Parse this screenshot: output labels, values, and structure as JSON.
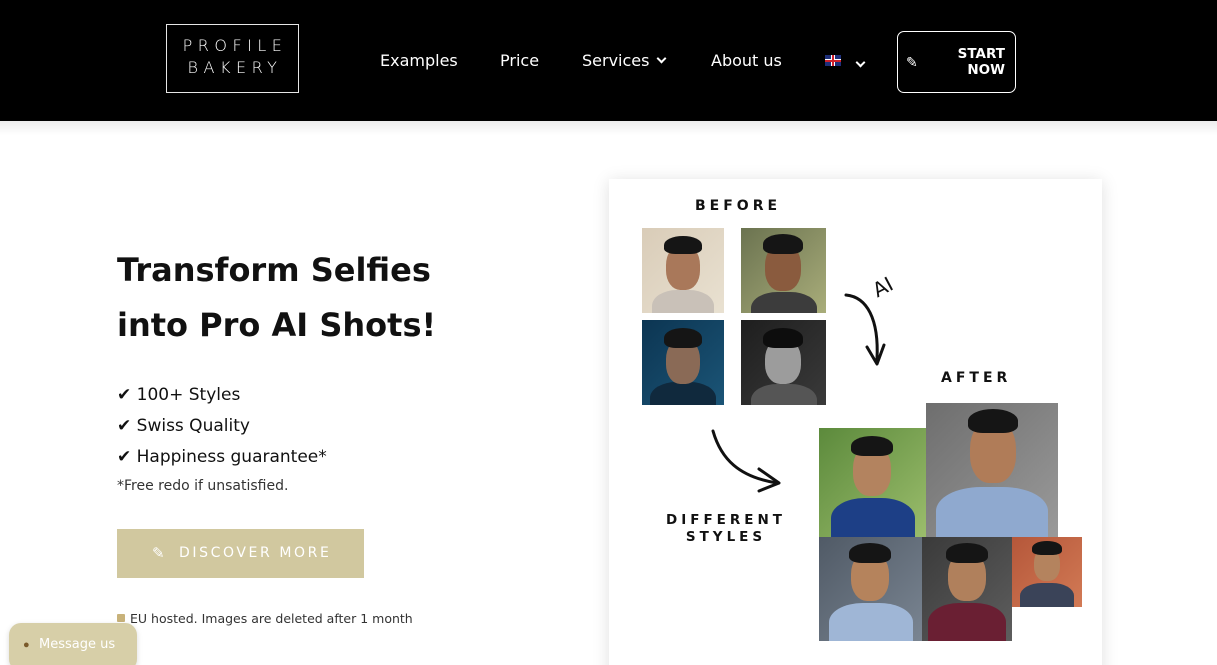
{
  "brand": {
    "line1": "PROFILE",
    "line2": "BAKERY"
  },
  "nav": {
    "examples": "Examples",
    "price": "Price",
    "services": "Services",
    "about": "About us"
  },
  "cta": {
    "start_line1": "START",
    "start_line2": "NOW"
  },
  "hero": {
    "headline_line1": "Transform Selfies",
    "headline_line2": "into Pro AI Shots!",
    "bullets": [
      "✔ 100+ Styles",
      "✔ Swiss Quality",
      "✔ Happiness guarantee*"
    ],
    "note": "*Free redo if unsatisfied.",
    "discover_label": "DISCOVER MORE",
    "privacy": "EU hosted. Images are deleted after 1 month"
  },
  "showcase": {
    "before_label": "BEFORE",
    "after_label": "AFTER",
    "ai_label": "AI",
    "styles_line1": "DIFFERENT",
    "styles_line2": "STYLES"
  },
  "chat": {
    "label": "Message us"
  },
  "colors": {
    "header_bg": "#000000",
    "accent": "#d1c89f",
    "chat_bg": "#d7cfa8"
  }
}
